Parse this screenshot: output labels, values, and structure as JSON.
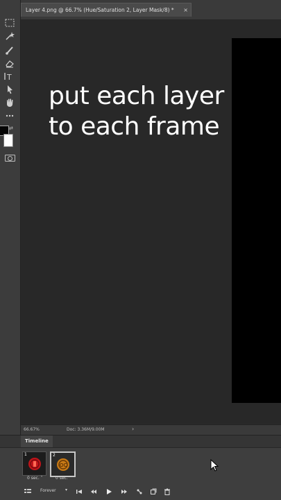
{
  "document": {
    "tab_title": "Layer 4.png @ 66.7% (Hue/Saturation 2, Layer Mask/8) *",
    "close_glyph": "×"
  },
  "canvas": {
    "caption_line1": "put each layer",
    "caption_line2": "to each frame"
  },
  "status_bar": {
    "zoom": "66.67%",
    "doc_info": "Doc: 3.36M/9.00M",
    "arrow": "›"
  },
  "timeline": {
    "tab_label": "Timeline",
    "frames": [
      {
        "number": "1",
        "delay": "0 sec.",
        "selected": false
      },
      {
        "number": "2",
        "delay": "0 sec.",
        "selected": true
      }
    ],
    "loop_option": "Forever"
  },
  "colors": {
    "panel_bg": "#3c3c3c",
    "canvas_bg": "#282828",
    "foreground_swatch": "#050505",
    "background_swatch": "#ffffff",
    "frame1_thumb": "#c0141a",
    "frame2_thumb": "#c87a16"
  }
}
